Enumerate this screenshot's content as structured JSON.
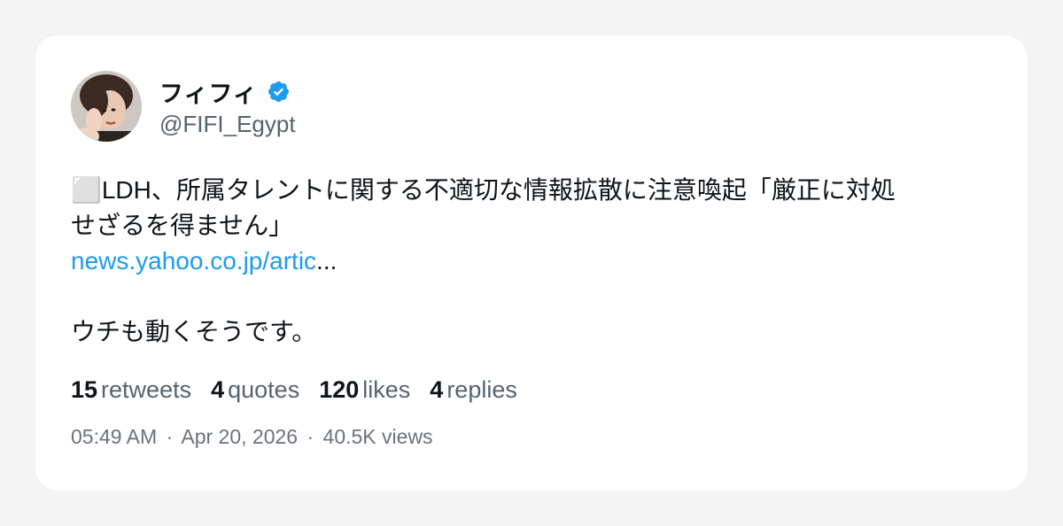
{
  "author": {
    "display_name": "フィフィ",
    "handle": "@FIFI_Egypt",
    "verified": true,
    "verified_color": "#1d9bf0"
  },
  "tweet": {
    "line1": "⬜LDH、所属タレントに関する不適切な情報拡散に注意喚起「厳正に対処",
    "line2": "せざるを得ません」",
    "link_text": "news.yahoo.co.jp/artic",
    "link_ellipsis": "...",
    "comment": "ウチも動くそうです。"
  },
  "stats": {
    "retweets_count": "15",
    "retweets_label": "retweets",
    "quotes_count": "4",
    "quotes_label": "quotes",
    "likes_count": "120",
    "likes_label": "likes",
    "replies_count": "4",
    "replies_label": "replies"
  },
  "meta": {
    "time": "05:49 AM",
    "date": "Apr 20, 2026",
    "views": "40.5K views",
    "separator": "·"
  },
  "colors": {
    "link": "#1d9bf0",
    "text": "#0f1419",
    "muted": "#536471",
    "background": "#f4f4f5",
    "card": "#ffffff"
  }
}
